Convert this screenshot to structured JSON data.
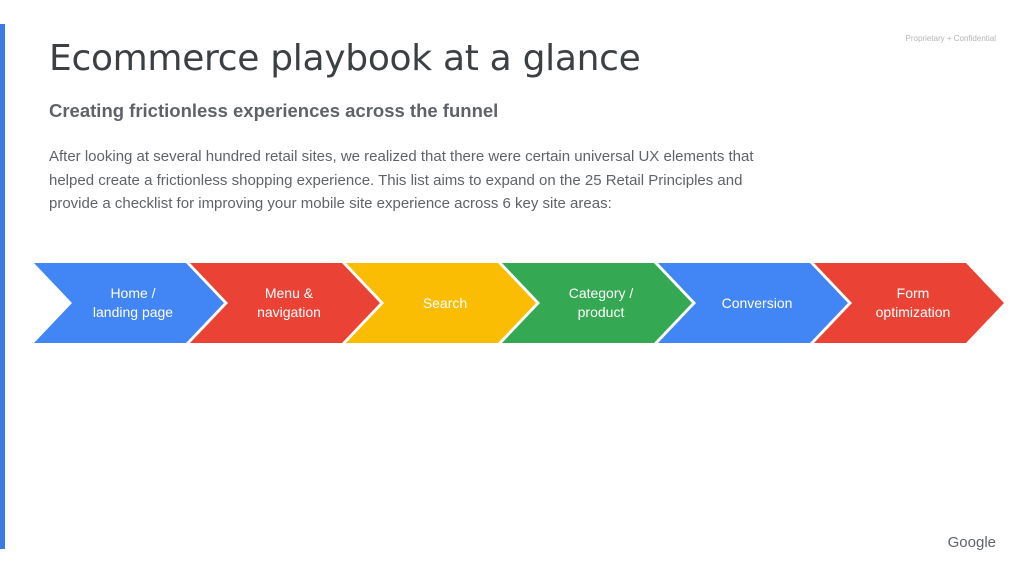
{
  "header": {
    "confidential": "Proprietary + Confidential",
    "title": "Ecommerce playbook at a glance",
    "subtitle": "Creating frictionless experiences across the funnel",
    "body": "After looking at several hundred retail sites, we realized that there were certain universal UX elements that helped create a frictionless shopping experience. This list aims to expand on the 25 Retail Principles and provide a checklist for improving your mobile site experience across 6 key site areas:"
  },
  "steps": [
    {
      "label": "Home /\nlanding page",
      "color": "#4285f4"
    },
    {
      "label": "Menu &\nnavigation",
      "color": "#ea4335"
    },
    {
      "label": "Search",
      "color": "#fbbc04"
    },
    {
      "label": "Category /\nproduct",
      "color": "#34a853"
    },
    {
      "label": "Conversion",
      "color": "#4285f4"
    },
    {
      "label": "Form\noptimization",
      "color": "#ea4335"
    }
  ],
  "footer": {
    "logo": "Google"
  },
  "colors": {
    "accent_bar": "#3b7be3"
  }
}
